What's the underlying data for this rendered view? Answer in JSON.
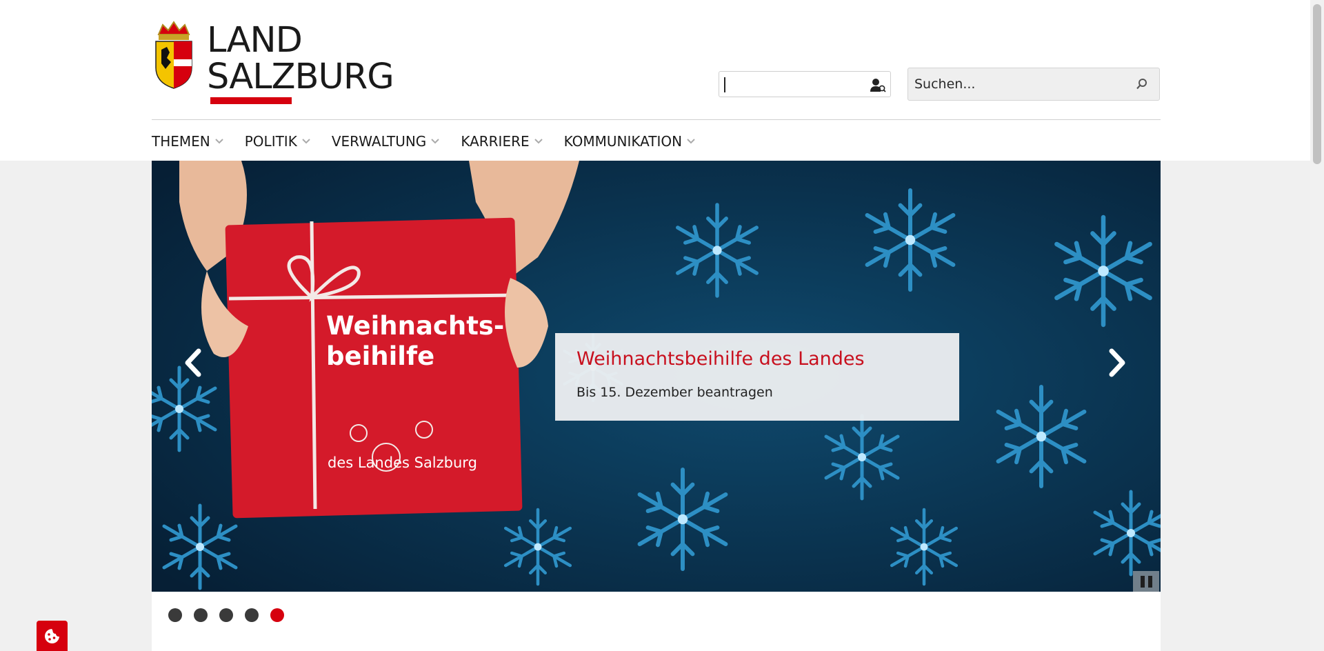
{
  "logo": {
    "line1": "LAND",
    "line2": "SALZBURG",
    "brand_color": "#d6000e"
  },
  "header": {
    "ident_icon": "user-search-icon",
    "search": {
      "placeholder": "Suchen...",
      "icon": "search-icon"
    }
  },
  "nav": {
    "items": [
      {
        "label": "THEMEN"
      },
      {
        "label": "POLITIK"
      },
      {
        "label": "VERWALTUNG"
      },
      {
        "label": "KARRIERE"
      },
      {
        "label": "KOMMUNIKATION"
      }
    ]
  },
  "hero": {
    "gift_text1": "Weihnachts-",
    "gift_text2": "beihilfe",
    "gift_text3": "des Landes Salzburg",
    "caption_title": "Weihnachtsbeihilfe des Landes",
    "caption_subtitle": "Bis 15. Dezember beantragen",
    "slide_count": 5,
    "active_slide": 5
  },
  "colors": {
    "accent": "#d6000e",
    "caption_title": "#c8101e",
    "hero_bg": "#0a3250"
  }
}
